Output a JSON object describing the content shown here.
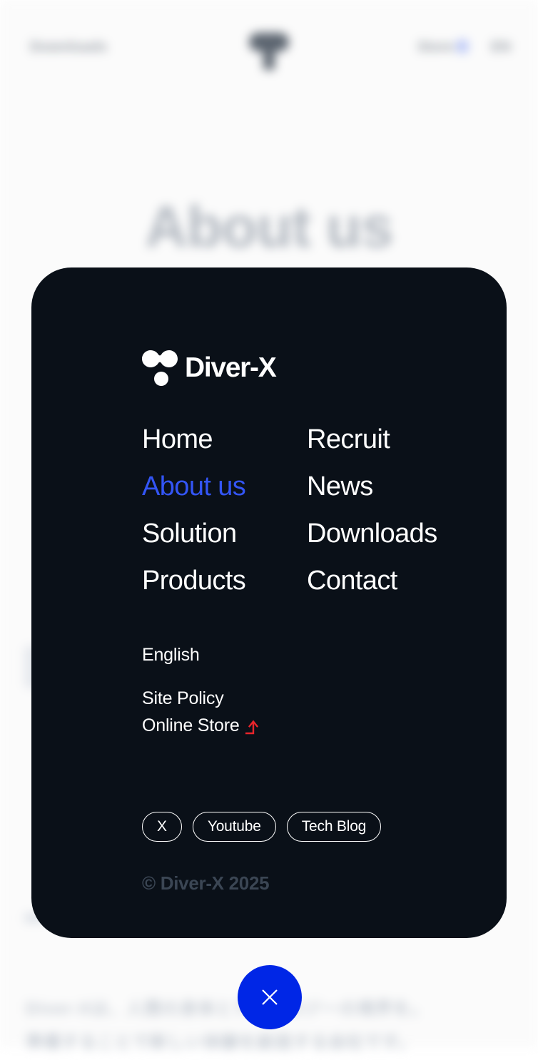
{
  "background": {
    "header": {
      "left_label": "Downloads",
      "logo_icon": "diver-x-logo-icon",
      "store_label": "Store",
      "store_icon": "cart-icon",
      "lang_label": "EN"
    },
    "page_title": "About us",
    "body_lines": [
      "Diver-Xは、人間の身体とテクノロジーの境界を。",
      "準備することで新しい体験を創造する会社です。"
    ]
  },
  "modal": {
    "brand": {
      "logo_icon": "diver-x-logo-icon",
      "name": "Diver-X"
    },
    "nav": [
      {
        "label": "Home",
        "active": false
      },
      {
        "label": "Recruit",
        "active": false
      },
      {
        "label": "About us",
        "active": true
      },
      {
        "label": "News",
        "active": false
      },
      {
        "label": "Solution",
        "active": false
      },
      {
        "label": "Downloads",
        "active": false
      },
      {
        "label": "Products",
        "active": false
      },
      {
        "label": "Contact",
        "active": false
      }
    ],
    "meta": {
      "language": "English",
      "site_policy": "Site Policy",
      "online_store": "Online Store",
      "online_store_icon": "external-link-arrow-icon"
    },
    "socials": [
      {
        "label": "X"
      },
      {
        "label": "Youtube"
      },
      {
        "label": "Tech Blog"
      }
    ],
    "copyright": "© Diver-X 2025"
  },
  "close_button": {
    "icon": "close-icon",
    "label": "Close menu"
  },
  "colors": {
    "modal_bg": "#0a1018",
    "accent_blue": "#0026e6",
    "active_link_blue": "#3355f5",
    "external_arrow_red": "#e8252b",
    "copyright_gray": "#3b4654",
    "page_bg": "#fbfbfb"
  }
}
